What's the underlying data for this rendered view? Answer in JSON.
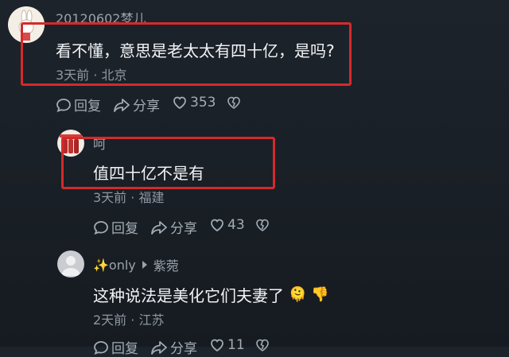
{
  "comments": [
    {
      "username": "20120602梦儿",
      "text": "看不懂，意思是老太太有四十亿，是吗?",
      "time": "3天前",
      "location": "北京",
      "reply_label": "回复",
      "share_label": "分享",
      "likes": "353"
    },
    {
      "username": "呵",
      "text": "值四十亿不是有",
      "time": "3天前",
      "location": "福建",
      "reply_label": "回复",
      "share_label": "分享",
      "likes": "43"
    },
    {
      "username": "✨only",
      "reply_to": "紫菀",
      "text": "这种说法是美化它们夫妻了",
      "emojis": [
        "🫠",
        "👎"
      ],
      "time": "2天前",
      "location": "江苏",
      "reply_label": "回复",
      "share_label": "分享",
      "likes": "11"
    }
  ],
  "separator": "·",
  "colors": {
    "highlight": "#d42a2a",
    "background": "#1a2027"
  },
  "icons": [
    "reply-icon",
    "share-icon",
    "heart-icon",
    "broken-heart-icon",
    "caret-right-icon"
  ]
}
